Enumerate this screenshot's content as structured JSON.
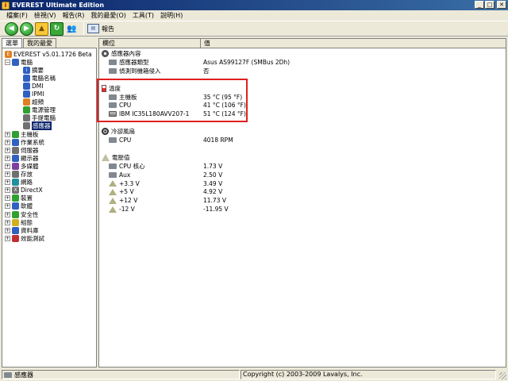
{
  "window": {
    "title": "EVEREST Ultimate Edition",
    "minimize": "_",
    "maximize": "□",
    "close": "✕"
  },
  "menu": [
    "檔案(F)",
    "檢視(V)",
    "報告(R)",
    "我的最愛(O)",
    "工具(T)",
    "說明(H)"
  ],
  "toolbar": {
    "report_label": "報告"
  },
  "left_tabs": [
    "選單",
    "我的最愛"
  ],
  "tree": [
    {
      "label": "EVEREST v5.01.1726 Beta",
      "indent": 0,
      "expander": "",
      "icon": "orange",
      "glyph": "E"
    },
    {
      "label": "電腦",
      "indent": 0,
      "expander": "−",
      "icon": "blue",
      "glyph": ""
    },
    {
      "label": "摘要",
      "indent": 2,
      "expander": "",
      "icon": "blue",
      "glyph": "i"
    },
    {
      "label": "電腦名稱",
      "indent": 2,
      "expander": "",
      "icon": "blue",
      "glyph": ""
    },
    {
      "label": "DMI",
      "indent": 2,
      "expander": "",
      "icon": "blue",
      "glyph": ""
    },
    {
      "label": "IPMI",
      "indent": 2,
      "expander": "",
      "icon": "blue",
      "glyph": ""
    },
    {
      "label": "超頻",
      "indent": 2,
      "expander": "",
      "icon": "orange",
      "glyph": ""
    },
    {
      "label": "電源管理",
      "indent": 2,
      "expander": "",
      "icon": "green",
      "glyph": ""
    },
    {
      "label": "手提電腦",
      "indent": 2,
      "expander": "",
      "icon": "gray",
      "glyph": ""
    },
    {
      "label": "感應器",
      "indent": 2,
      "expander": "",
      "icon": "gray",
      "glyph": "",
      "selected": true
    },
    {
      "label": "主機板",
      "indent": 0,
      "expander": "+",
      "icon": "green",
      "glyph": ""
    },
    {
      "label": "作業系統",
      "indent": 0,
      "expander": "+",
      "icon": "blue",
      "glyph": ""
    },
    {
      "label": "伺服器",
      "indent": 0,
      "expander": "+",
      "icon": "gray",
      "glyph": ""
    },
    {
      "label": "顯示器",
      "indent": 0,
      "expander": "+",
      "icon": "blue",
      "glyph": ""
    },
    {
      "label": "多媒體",
      "indent": 0,
      "expander": "+",
      "icon": "purple",
      "glyph": ""
    },
    {
      "label": "存放",
      "indent": 0,
      "expander": "+",
      "icon": "gray",
      "glyph": ""
    },
    {
      "label": "網路",
      "indent": 0,
      "expander": "+",
      "icon": "teal",
      "glyph": ""
    },
    {
      "label": "DirectX",
      "indent": 0,
      "expander": "+",
      "icon": "gray",
      "glyph": "X"
    },
    {
      "label": "裝置",
      "indent": 0,
      "expander": "+",
      "icon": "green",
      "glyph": ""
    },
    {
      "label": "軟體",
      "indent": 0,
      "expander": "+",
      "icon": "blue",
      "glyph": ""
    },
    {
      "label": "安全性",
      "indent": 0,
      "expander": "+",
      "icon": "green",
      "glyph": ""
    },
    {
      "label": "組態",
      "indent": 0,
      "expander": "+",
      "icon": "yellow",
      "glyph": ""
    },
    {
      "label": "資料庫",
      "indent": 0,
      "expander": "+",
      "icon": "blue",
      "glyph": ""
    },
    {
      "label": "效能測試",
      "indent": 0,
      "expander": "+",
      "icon": "red",
      "glyph": ""
    }
  ],
  "columns": {
    "field": "欄位",
    "value": "值"
  },
  "rows": [
    {
      "type": "section",
      "icon": "sensor",
      "field": "感應器內容",
      "value": ""
    },
    {
      "type": "item",
      "icon": "chip",
      "field": "感應器類型",
      "value": "Asus AS99127F  (SMBus 2Dh)"
    },
    {
      "type": "item",
      "icon": "chip",
      "field": "偵測到機箱侵入",
      "value": "否"
    },
    {
      "type": "blank"
    },
    {
      "type": "section",
      "icon": "temp",
      "field": "溫度",
      "value": ""
    },
    {
      "type": "item",
      "icon": "chip",
      "field": "主機板",
      "value": "35 °C  (95 °F)"
    },
    {
      "type": "item",
      "icon": "chip",
      "field": "CPU",
      "value": "41 °C  (106 °F)"
    },
    {
      "type": "item",
      "icon": "hdd",
      "field": "IBM IC35L180AVV207-1",
      "value": "51 °C  (124 °F)"
    },
    {
      "type": "blank"
    },
    {
      "type": "section",
      "icon": "fan",
      "field": "冷卻風扇",
      "value": ""
    },
    {
      "type": "item",
      "icon": "chip",
      "field": "CPU",
      "value": "4018 RPM"
    },
    {
      "type": "blank"
    },
    {
      "type": "section",
      "icon": "volt",
      "field": "電壓值",
      "value": ""
    },
    {
      "type": "item",
      "icon": "chip",
      "field": "CPU 核心",
      "value": "1.73 V"
    },
    {
      "type": "item",
      "icon": "chip",
      "field": "Aux",
      "value": "2.50 V"
    },
    {
      "type": "item",
      "icon": "warn",
      "field": "+3.3 V",
      "value": "3.49 V"
    },
    {
      "type": "item",
      "icon": "warn",
      "field": "+5 V",
      "value": "4.92 V"
    },
    {
      "type": "item",
      "icon": "warn",
      "field": "+12 V",
      "value": "11.73 V"
    },
    {
      "type": "item",
      "icon": "warn",
      "field": "-12 V",
      "value": "-11.95 V"
    }
  ],
  "status": {
    "left": "感應器",
    "right": "Copyright (c) 2003-2009 Lavalys, Inc."
  }
}
